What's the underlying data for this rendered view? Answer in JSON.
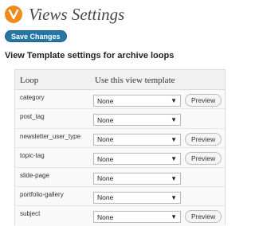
{
  "header": {
    "title": "Views Settings"
  },
  "toolbar": {
    "save_label": "Save Changes"
  },
  "section": {
    "title": "View Template settings for archive loops"
  },
  "table": {
    "col_loop": "Loop",
    "col_template": "Use this view template",
    "rows": [
      {
        "label": "category",
        "select": "None",
        "preview": "Preview"
      },
      {
        "label": "post_tag",
        "select": "None",
        "preview": ""
      },
      {
        "label": "newsletter_user_type",
        "select": "None",
        "preview": "Preview"
      },
      {
        "label": "topic-tag",
        "select": "None",
        "preview": "Preview"
      },
      {
        "label": "slide-page",
        "select": "None",
        "preview": ""
      },
      {
        "label": "portfolio-gallery",
        "select": "None",
        "preview": ""
      },
      {
        "label": "subject",
        "select": "None",
        "preview": "Preview"
      }
    ]
  },
  "colors": {
    "accent": "#2578a6",
    "logo": "#f08a1c"
  }
}
